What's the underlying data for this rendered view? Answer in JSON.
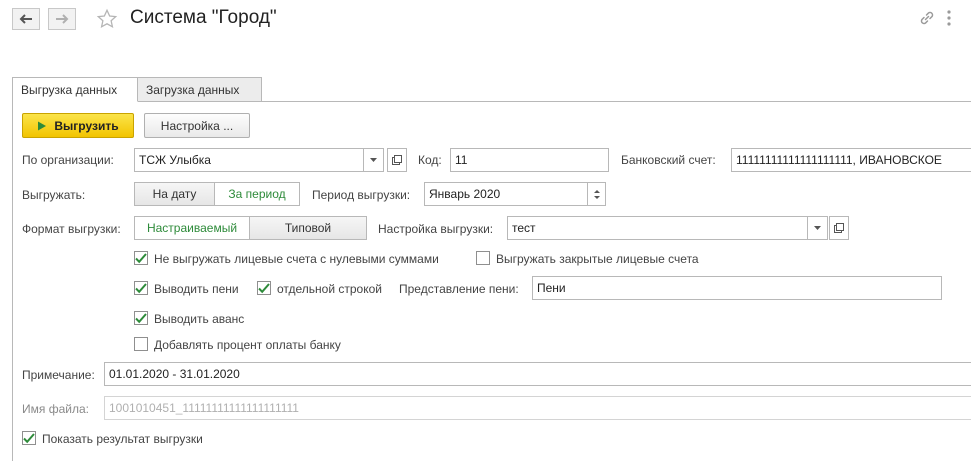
{
  "window": {
    "title": "Система \"Город\""
  },
  "tabs": [
    {
      "label": "Выгрузка данных"
    },
    {
      "label": "Загрузка данных"
    }
  ],
  "toolbar": {
    "export_label": "Выгрузить",
    "settings_label": "Настройка ..."
  },
  "organization": {
    "label": "По организации:",
    "value": "ТСЖ Улыбка"
  },
  "code": {
    "label": "Код:",
    "value": "11"
  },
  "bank_account": {
    "label": "Банковский счет:",
    "value": "11111111111111111111, ИВАНОВСКОЕ"
  },
  "export_mode": {
    "label": "Выгружать:",
    "options": [
      "На дату",
      "За период"
    ],
    "selected": "За период"
  },
  "period": {
    "label": "Период выгрузки:",
    "value": "Январь 2020"
  },
  "format": {
    "label": "Формат выгрузки:",
    "options": [
      "Настраиваемый",
      "Типовой"
    ],
    "selected": "Настраиваемый"
  },
  "export_settings": {
    "label": "Настройка выгрузки:",
    "value": "тест"
  },
  "checkboxes": {
    "skip_zero": {
      "label": "Не выгружать лицевые счета с нулевыми суммами",
      "checked": true
    },
    "export_closed": {
      "label": "Выгружать закрытые лицевые счета",
      "checked": false
    },
    "show_penalty": {
      "label": "Выводить пени",
      "checked": true
    },
    "separate_line": {
      "label": "отдельной строкой",
      "checked": true
    },
    "show_advance": {
      "label": "Выводить аванс",
      "checked": true
    },
    "add_bank_fee": {
      "label": "Добавлять процент оплаты банку",
      "checked": false
    },
    "show_result": {
      "label": "Показать результат выгрузки",
      "checked": true
    }
  },
  "penalty_repr": {
    "label": "Представление пени:",
    "value": "Пени"
  },
  "note": {
    "label": "Примечание:",
    "value": "01.01.2020 - 31.01.2020"
  },
  "filename": {
    "label": "Имя файла:",
    "value": "1001010451_11111111111111111111"
  },
  "colors": {
    "accent_green": "#2e8b3a",
    "primary_yellow": "#f2c400",
    "check_green": "#2e8b3a"
  },
  "icons": [
    "back-arrow-icon",
    "forward-arrow-icon",
    "star-icon",
    "link-icon",
    "more-icon",
    "play-icon",
    "dropdown-arrow-icon",
    "open-form-icon",
    "checkmark-icon"
  ]
}
